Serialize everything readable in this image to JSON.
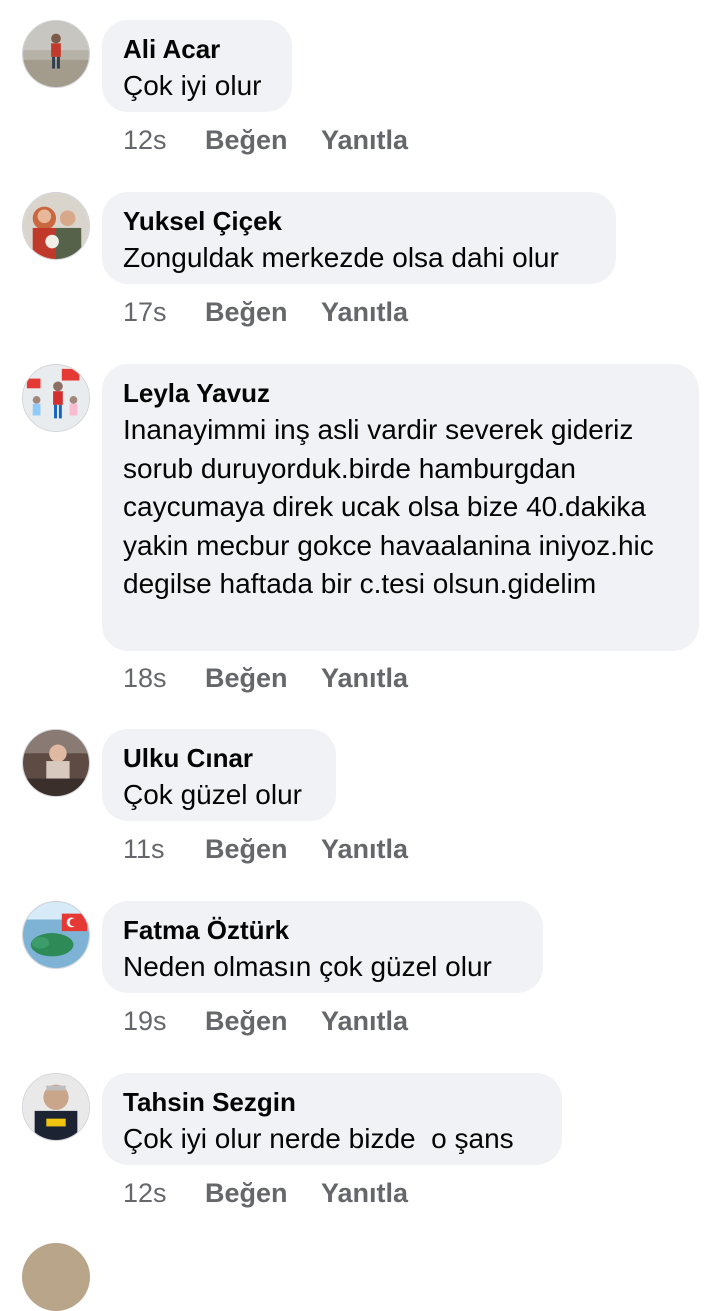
{
  "comments": [
    {
      "name": "Ali Acar",
      "text": "Çok iyi olur",
      "time": "12s",
      "like": "Beğen",
      "reply": "Yanıtla"
    },
    {
      "name": "Yuksel Çiçek",
      "text": "Zonguldak merkezde olsa dahi olur",
      "time": "17s",
      "like": "Beğen",
      "reply": "Yanıtla"
    },
    {
      "name": "Leyla Yavuz",
      "text": "Inanayimmi inş asli vardir severek gideriz sorub duruyorduk.birde hamburgdan caycumaya direk ucak olsa bize 40.dakika yakin mecbur gokce havaalanina iniyoz.hic degilse haftada bir c.tesi olsun.gidelim",
      "time": "18s",
      "like": "Beğen",
      "reply": "Yanıtla"
    },
    {
      "name": "Ulku Cınar",
      "text": "Çok güzel olur",
      "time": "11s",
      "like": "Beğen",
      "reply": "Yanıtla"
    },
    {
      "name": "Fatma Öztürk",
      "text": "Neden olmasın çok güzel olur",
      "time": "19s",
      "like": "Beğen",
      "reply": "Yanıtla"
    },
    {
      "name": "Tahsin Sezgin",
      "text": "Çok iyi olur nerde bizde  o şans",
      "time": "12s",
      "like": "Beğen",
      "reply": "Yanıtla"
    }
  ],
  "colors": {
    "bubble": "#f0f2f5",
    "name": "#050505",
    "meta": "#65676b"
  }
}
